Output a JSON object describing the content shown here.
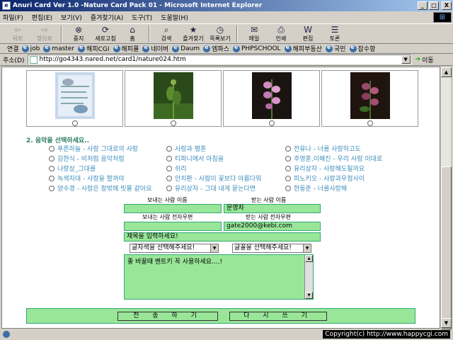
{
  "window": {
    "title": "Anuri Card Ver 1.0 -Nature Card Pack 01 - Microsoft Internet Explorer",
    "controls": [
      "_",
      "□",
      "X"
    ]
  },
  "menu": [
    "파일(F)",
    "편집(E)",
    "보기(V)",
    "즐겨찾기(A)",
    "도구(T)",
    "도움말(H)"
  ],
  "toolbar": [
    {
      "label": "뒤로",
      "icon": "back-arrow-icon",
      "glyph": "⇦",
      "disabled": true
    },
    {
      "label": "앞으로",
      "icon": "forward-arrow-icon",
      "glyph": "⇨",
      "disabled": true
    },
    {
      "label": "중지",
      "icon": "stop-icon",
      "glyph": "⊗",
      "disabled": false
    },
    {
      "label": "새로고침",
      "icon": "refresh-icon",
      "glyph": "⟳",
      "disabled": false
    },
    {
      "label": "홈",
      "icon": "home-icon",
      "glyph": "⌂",
      "disabled": false
    },
    {
      "label": "검색",
      "icon": "search-icon",
      "glyph": "⌕",
      "disabled": false
    },
    {
      "label": "즐겨찾기",
      "icon": "favorites-icon",
      "glyph": "★",
      "disabled": false
    },
    {
      "label": "목록보기",
      "icon": "history-icon",
      "glyph": "◷",
      "disabled": false
    },
    {
      "label": "메일",
      "icon": "mail-icon",
      "glyph": "✉",
      "disabled": false
    },
    {
      "label": "인쇄",
      "icon": "print-icon",
      "glyph": "⎙",
      "disabled": false
    },
    {
      "label": "편집",
      "icon": "edit-icon",
      "glyph": "W",
      "disabled": false
    },
    {
      "label": "토론",
      "icon": "discuss-icon",
      "glyph": "☰",
      "disabled": false
    }
  ],
  "links": {
    "label": "연결",
    "items": [
      "job",
      "master",
      "해피CGI",
      "해피몰",
      "네이버",
      "Daum",
      "엠파스",
      "PHPSCHOOL",
      "해피부동산",
      "국민",
      "잡수항"
    ]
  },
  "address": {
    "label": "주소(D)",
    "url": "http://go4343.nared.net/card1/nature024.htm",
    "go_label": "이동"
  },
  "music": {
    "title": "2. 음악을 선택하세요..",
    "options": [
      [
        "푸른하늘 - 사랑 그대로의 사랑",
        "사랑과 평혼",
        "전유나 - 너를 사랑하고도"
      ],
      [
        "김현식 - 비처럼 음악처럼",
        "티파니에서 아침을",
        "주영훈,이혜진 - 우리 사랑 이대로"
      ],
      [
        "나랑상_그대를",
        "쉬리",
        "유리상자 - 사랑해도될까요"
      ],
      [
        "녹색지대 - 사랑을 할꺼야",
        "안치환 - 사람이 꽃보다 아름다워",
        "피노키오 - 사랑과우정사이"
      ],
      [
        "양수경 - 사랑은 창밖에 빗물 같아요",
        "유리상자 - 그대 내게 묻는다면",
        "한동준 - 너를사랑해"
      ]
    ]
  },
  "form": {
    "sender_name_label": "보내는 사람 이름",
    "receiver_name_label": "받는 사람 이름",
    "sender_name": "",
    "receiver_name": "문영차",
    "sender_email_label": "보내는 사람 전자우편",
    "receiver_email_label": "받는 사람 전자우편",
    "sender_email": "",
    "receiver_email": "gate2000@kebi.com",
    "subject": "제목을 입력하세요!",
    "color_select": "글자색을 선택해주세요!",
    "font_select": "글꼴을 선택해주세요!",
    "message": "좋 바꿀때 벤트키 꼭 사용하세요....!",
    "send_button": "전 송 하 기",
    "reset_button": "다 시 쓰 기"
  },
  "status": {
    "copyright": "Copyright(c) http://www.happycgi.com"
  },
  "colors": {
    "field_green": "#99e699",
    "music_title": "#2e7d62",
    "music_link": "#3c8dbc"
  }
}
